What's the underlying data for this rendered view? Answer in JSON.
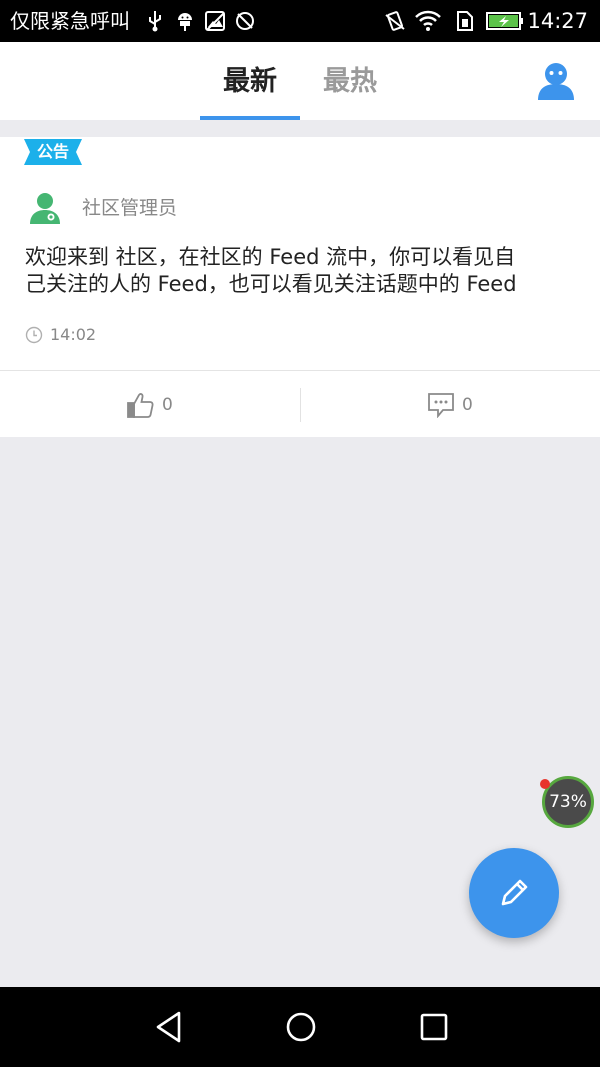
{
  "status_bar": {
    "carrier": "仅限紧急呼叫",
    "time": "14:27",
    "icons": [
      "usb-icon",
      "android-debug-icon",
      "image-icon",
      "sync-off-icon",
      "vibrate-icon",
      "wifi-icon",
      "sim-icon",
      "battery-charging-icon"
    ]
  },
  "header": {
    "tabs": [
      {
        "label": "最新",
        "active": true
      },
      {
        "label": "最热",
        "active": false
      }
    ],
    "profile_icon": "user-icon"
  },
  "feed": {
    "items": [
      {
        "tag": "公告",
        "author": "社区管理员",
        "content_lines": [
          "欢迎来到 社区，在社区的 Feed 流中，你可以看见自",
          "己关注的人的 Feed，也可以看见关注话题中的 Feed"
        ],
        "time": "14:02",
        "likes": "0",
        "comments": "0"
      }
    ]
  },
  "floating": {
    "memory_percent": "73%",
    "compose_icon": "pencil-icon"
  },
  "nav_bar": {
    "buttons": [
      "back-icon",
      "home-icon",
      "recents-icon"
    ]
  },
  "colors": {
    "accent": "#3d94ec",
    "notice_tag": "#1cb0ea",
    "admin_avatar": "#45b672",
    "background": "#ebebef"
  }
}
